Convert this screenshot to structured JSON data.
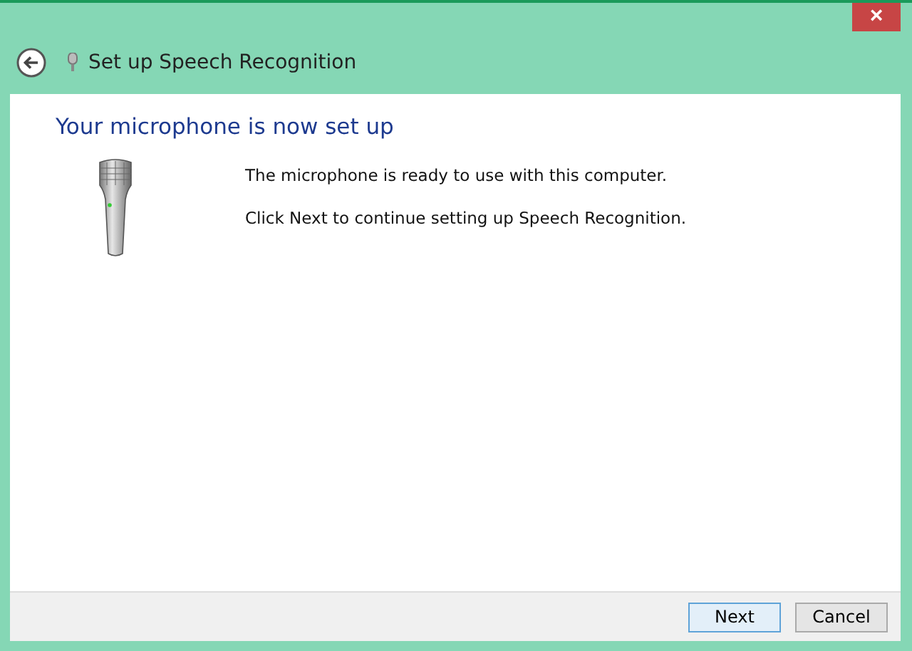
{
  "window": {
    "close": "×"
  },
  "header": {
    "title": "Set up Speech Recognition"
  },
  "content": {
    "heading": "Your microphone is now set up",
    "paragraphs": [
      "The microphone is ready to use with this computer.",
      "Click Next to continue setting up Speech Recognition."
    ]
  },
  "buttons": [
    {
      "label": "Next",
      "default": true
    },
    {
      "label": "Cancel",
      "default": false
    }
  ]
}
